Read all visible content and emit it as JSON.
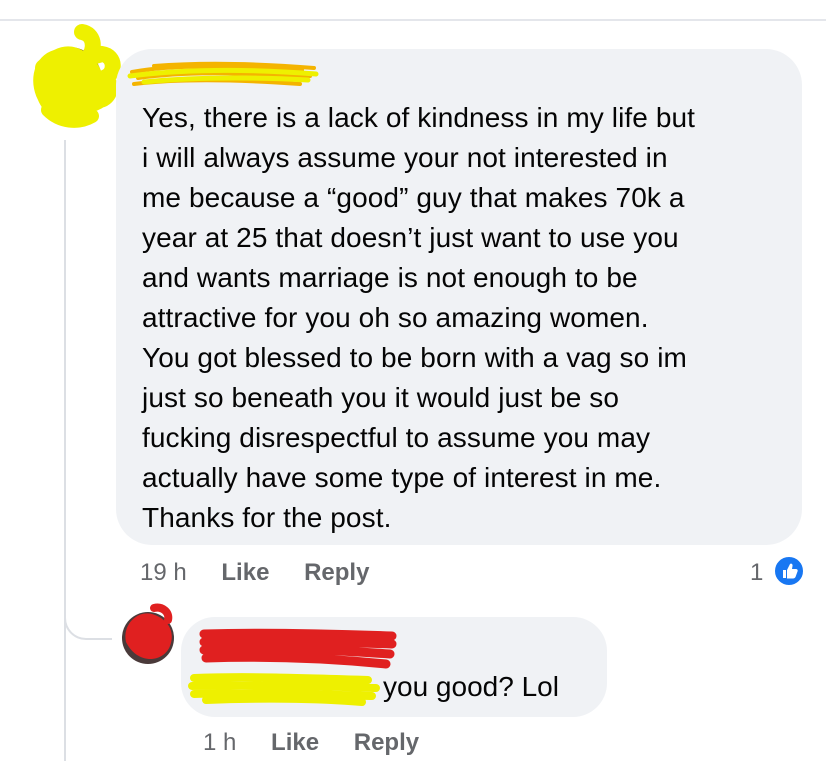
{
  "comment": {
    "text": "Yes, there is a lack of kindness in my life but\ni will always assume your not interested in\nme because a “good” guy that makes 70k a\nyear at 25 that doesn’t just want to use you\nand wants marriage is not enough to be\nattractive for you oh so amazing women.\nYou got blessed to be born with a vag so im\njust so beneath you it would just be so\nfucking disrespectful to assume you may\nactually have some type of interest in me.\nThanks for the post.",
    "time": "19 h",
    "like_label": "Like",
    "reply_label": "Reply",
    "reaction_count": "1",
    "reaction_icon": "thumbs-up-icon",
    "author_redacted": true
  },
  "reply": {
    "text": "you good? Lol",
    "time": "1 h",
    "like_label": "Like",
    "reply_label": "Reply",
    "author_redacted": true
  },
  "colors": {
    "bubble": "#f0f2f5",
    "meta_text": "#65676b",
    "like_blue": "#1877f2",
    "scribble_yellow": "#eef000",
    "scribble_red": "#e02020",
    "scribble_orange": "#f4b400"
  }
}
